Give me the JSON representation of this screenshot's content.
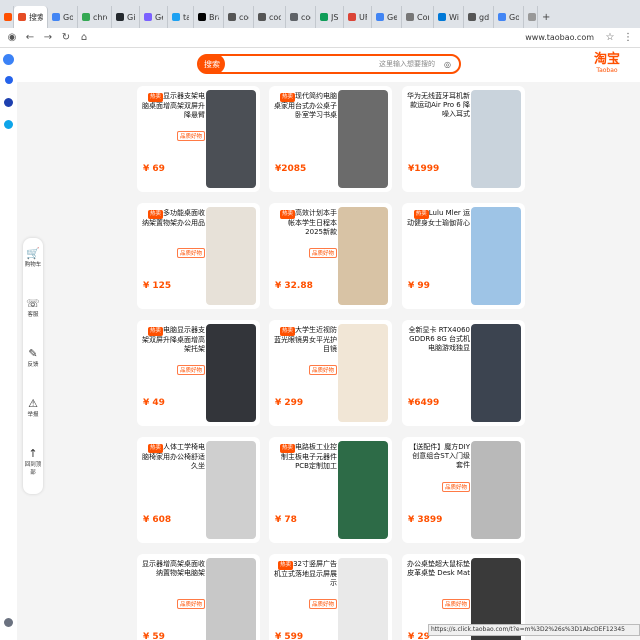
{
  "tabs": [
    {
      "label": "X",
      "favicon": "#ff5000"
    },
    {
      "label": "搜索",
      "favicon": "#e54d26"
    },
    {
      "label": "Google",
      "favicon": "#4285f4"
    },
    {
      "label": "chrome",
      "favicon": "#34a853"
    },
    {
      "label": "GitHub",
      "favicon": "#24292e"
    },
    {
      "label": "Gen",
      "favicon": "#7b61ff"
    },
    {
      "label": "tap",
      "favicon": "#1da1f2"
    },
    {
      "label": "Brand",
      "favicon": "#000000"
    },
    {
      "label": "codeb",
      "favicon": "#555555"
    },
    {
      "label": "codelon",
      "favicon": "#555555"
    },
    {
      "label": "codelo",
      "favicon": "#5f6368"
    },
    {
      "label": "JSK",
      "favicon": "#0f9d58"
    },
    {
      "label": "UFO",
      "favicon": "#db4437"
    },
    {
      "label": "Gemi",
      "favicon": "#4285f4"
    },
    {
      "label": "Comput",
      "favicon": "#777777"
    },
    {
      "label": "Wind",
      "favicon": "#0078d7"
    },
    {
      "label": "gdeds",
      "favicon": "#555555"
    },
    {
      "label": "Google",
      "favicon": "#4285f4"
    },
    {
      "label": "",
      "favicon": "#999999"
    }
  ],
  "toolbar": {
    "url": "www.taobao.com"
  },
  "header": {
    "logo": "淘宝",
    "logo_sub": "Taobao",
    "search_button": "搜索",
    "search_placeholder": "这里输入想要搜的",
    "camera_icon": "camera-icon"
  },
  "products": [
    {
      "title": "华为无线蓝牙耳机新款运动Air Pro 6 降噪入耳式",
      "tag": "",
      "price": "¥1999",
      "badge": ""
    },
    {
      "title": "现代简约电脑桌家用台式办公桌子卧室学习书桌",
      "tag": "",
      "price": "¥2085",
      "badge": "热卖"
    },
    {
      "title": "显示器支架电脑桌面增高架双屏升降悬臂",
      "tag": "品质好物",
      "price": "¥ 69",
      "badge": "热卖"
    },
    {
      "title": "Lulu Mler 运动健身女士瑜伽背心",
      "tag": "",
      "price": "¥ 99",
      "badge": "热卖"
    },
    {
      "title": "高效计划本手帐本学生日程本2025新款",
      "tag": "品质好物",
      "price": "¥ 32.88",
      "badge": "热卖"
    },
    {
      "title": "多功能桌面收纳架置物架办公用品",
      "tag": "品质好物",
      "price": "¥ 125",
      "badge": "热卖"
    },
    {
      "title": "全新显卡 RTX4060 GDDR6 8G 台式机电脑游戏独显",
      "tag": "",
      "price": "¥6499",
      "badge": ""
    },
    {
      "title": "大学生近视防蓝光眼镜男女平光护目镜",
      "tag": "品质好物",
      "price": "¥ 299",
      "badge": "热卖"
    },
    {
      "title": "电脑显示器支架双屏升降桌面增高架托架",
      "tag": "品质好物",
      "price": "¥ 49",
      "badge": "热卖"
    },
    {
      "title": "【送配件】魔方DIY创意组合ST入门级套件",
      "tag": "品质好物",
      "price": "¥ 3899",
      "badge": ""
    },
    {
      "title": "电路板工业控制主板电子元器件PCB定制加工",
      "tag": "",
      "price": "¥ 78",
      "badge": "热卖"
    },
    {
      "title": "人体工学椅电脑椅家用办公椅舒适久坐",
      "tag": "",
      "price": "¥ 608",
      "badge": "热卖"
    },
    {
      "title": "办公桌垫超大鼠标垫皮革桌垫 Desk Mat",
      "tag": "品质好物",
      "price": "¥ 29",
      "badge": ""
    },
    {
      "title": "32寸竖屏广告机立式落地显示屏展示",
      "tag": "品质好物",
      "price": "¥ 599",
      "badge": "热卖"
    },
    {
      "title": "显示器增高架桌面收纳置物架电脑架",
      "tag": "品质好物",
      "price": "¥ 59",
      "badge": ""
    }
  ],
  "floatbar": [
    {
      "label": "购物车",
      "icon": "cart-icon",
      "glyph": "🛒"
    },
    {
      "label": "客服",
      "icon": "headset-icon",
      "glyph": "☏"
    },
    {
      "label": "反馈",
      "icon": "feedback-icon",
      "glyph": "✎"
    },
    {
      "label": "举报",
      "icon": "warning-icon",
      "glyph": "⚠"
    },
    {
      "label": "回到顶部",
      "icon": "arrow-up-icon",
      "glyph": "↑"
    }
  ],
  "statusbar": {
    "text": "https://s.click.taobao.com/t?e=m%3D2%26s%3D1AbcDEF12345"
  },
  "colors": {
    "accent": "#ff5000"
  }
}
